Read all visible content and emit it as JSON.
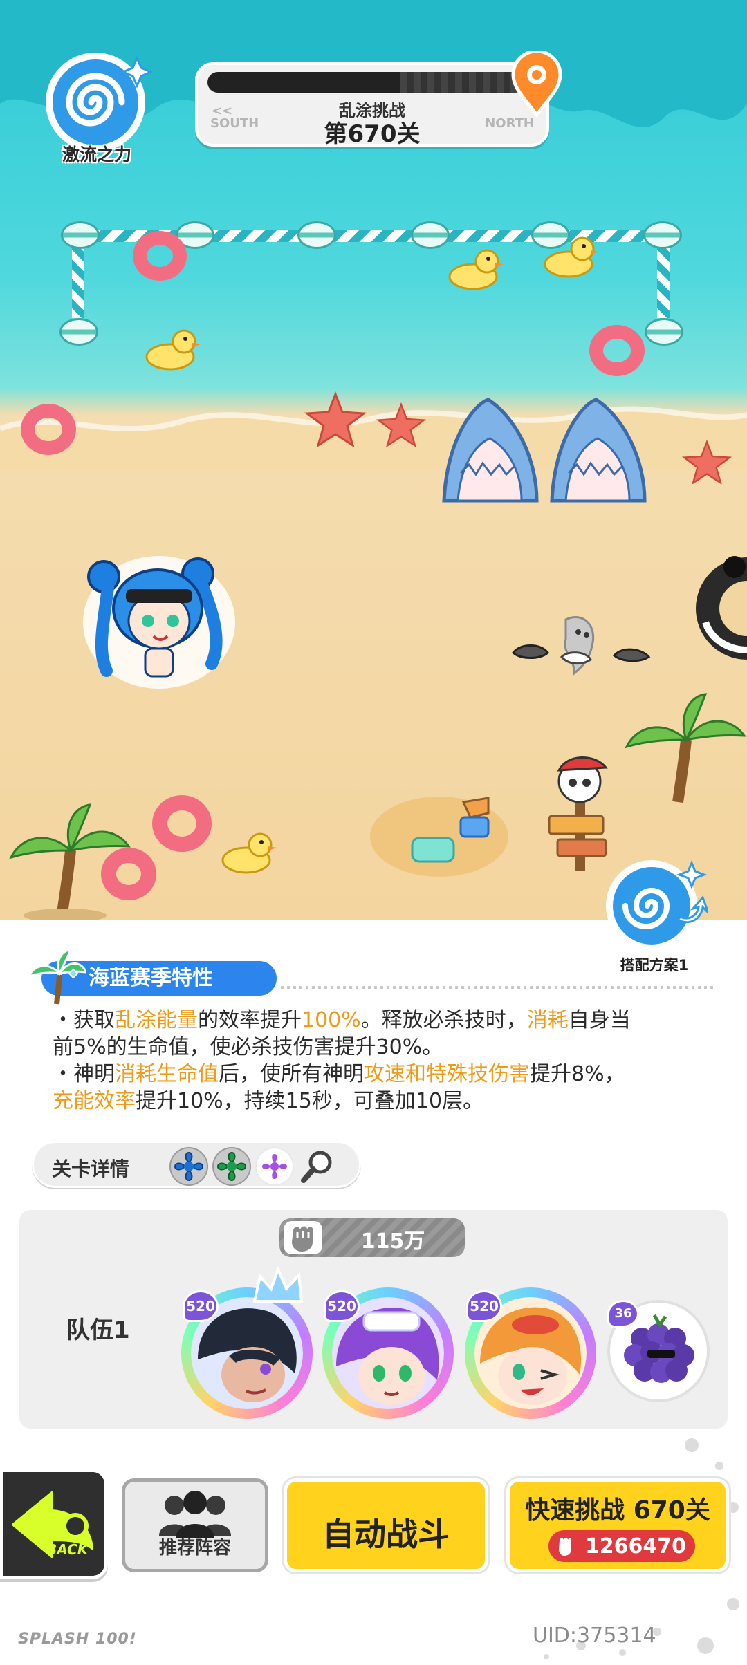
{
  "hud": {
    "power_badge_label": "激流之力",
    "stage_mode": "乱涂挑战",
    "stage_level": "第670关",
    "south_label": "SOUTH",
    "north_label": "NORTH",
    "arrows": "<<"
  },
  "loadout": {
    "label": "搭配方案1"
  },
  "season": {
    "title": "海蓝赛季特性",
    "line1": [
      {
        "t": "・获取",
        "hl": false
      },
      {
        "t": "乱涂能量",
        "hl": true
      },
      {
        "t": "的效率提升",
        "hl": false
      },
      {
        "t": "100%",
        "hl": true
      },
      {
        "t": "。释放必杀技时，",
        "hl": false
      },
      {
        "t": "消耗",
        "hl": true
      },
      {
        "t": "自身当",
        "hl": false
      }
    ],
    "line2": [
      {
        "t": "前5%的生命值，使必杀技伤害提升30%。",
        "hl": false
      }
    ],
    "line3": [
      {
        "t": "・神明",
        "hl": false
      },
      {
        "t": "消耗生命值",
        "hl": true
      },
      {
        "t": "后，使所有神明",
        "hl": false
      },
      {
        "t": "攻速和特殊技伤害",
        "hl": true
      },
      {
        "t": "提升8%，",
        "hl": false
      }
    ],
    "line4": [
      {
        "t": "充能效率",
        "hl": true
      },
      {
        "t": "提升10%，持续15秒，可叠加10层。",
        "hl": false
      }
    ],
    "highlight_color": "#f09a16"
  },
  "details": {
    "title": "关卡详情",
    "chips": [
      {
        "name": "blue-gear-icon",
        "color": "#1f6fd1"
      },
      {
        "name": "green-gear-icon",
        "color": "#1f9c4a"
      },
      {
        "name": "purple-gear-icon",
        "color": "#a64ee6"
      },
      {
        "name": "magnifier-icon",
        "color": "#444444"
      }
    ]
  },
  "team": {
    "label": "队伍1",
    "power": "115万",
    "heroes": [
      {
        "level": "520",
        "name": "hero-dark-hair"
      },
      {
        "level": "520",
        "name": "hero-purple-hair"
      },
      {
        "level": "520",
        "name": "hero-orange-hair"
      }
    ],
    "pet": {
      "level": "36"
    }
  },
  "actions": {
    "back": "BACK",
    "recommend": "推荐阵容",
    "auto": "自动战斗",
    "quick": "快速挑战 670关",
    "quick_cost": "1266470"
  },
  "footer": {
    "logo": "SPLASH 100!",
    "uid": "UID:375314"
  },
  "colors": {
    "sea": "#2fc9d6",
    "sand": "#f3d59f",
    "accent_yellow": "#ffd21e",
    "season_blue": "#2b85ec",
    "slime": "#d9ff2a"
  }
}
